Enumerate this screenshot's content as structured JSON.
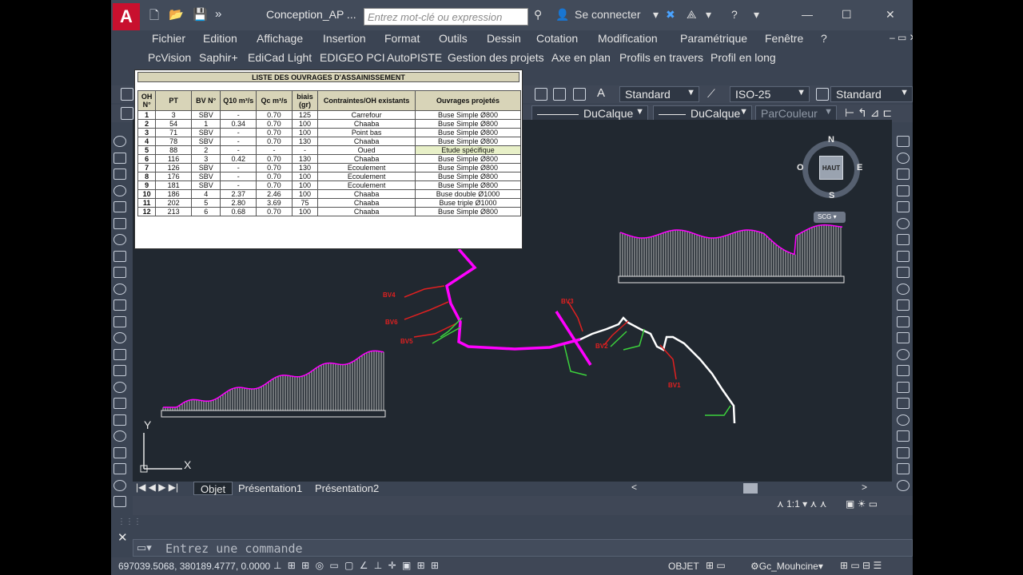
{
  "window": {
    "title": "Conception_AP ...",
    "search_placeholder": "Entrez mot-clé ou expression",
    "signin": "Se connecter",
    "help": "?",
    "min": "—",
    "max": "☐",
    "close": "✕"
  },
  "menu": [
    "Fichier",
    "Edition",
    "Affichage",
    "Insertion",
    "Format",
    "Outils",
    "Dessin",
    "Cotation",
    "Modification",
    "Paramétrique",
    "Fenêtre",
    "?"
  ],
  "menu2": [
    "PcVision",
    "Saphir+",
    "EdiCad Light",
    "EDIGEO PCI",
    "AutoPISTE",
    "Gestion des projets",
    "Axe en plan",
    "Profils en travers",
    "Profil en long"
  ],
  "toolbar": {
    "text_style": "Standard",
    "dim_style": "ISO-25",
    "table_style": "Standard",
    "linetype": "DuCalque",
    "lineweight": "DuCalque",
    "plotstyle": "ParCouleur"
  },
  "table": {
    "title": "LISTE DES OUVRAGES D'ASSAINISSEMENT",
    "headers": [
      "OH N°",
      "PT",
      "BV N°",
      "Q10 m³/s",
      "Qc m³/s",
      "biais (gr)",
      "Contraintes/OH existants",
      "Ouvrages projetés"
    ],
    "rows": [
      [
        "1",
        "3",
        "SBV",
        "-",
        "0.70",
        "125",
        "Carrefour",
        "Buse Simple Ø800"
      ],
      [
        "2",
        "54",
        "1",
        "0.34",
        "0.70",
        "100",
        "Chaaba",
        "Buse Simple Ø800"
      ],
      [
        "3",
        "71",
        "SBV",
        "-",
        "0.70",
        "100",
        "Point bas",
        "Buse Simple Ø800"
      ],
      [
        "4",
        "78",
        "SBV",
        "-",
        "0.70",
        "130",
        "Chaaba",
        "Buse Simple Ø800"
      ],
      [
        "5",
        "88",
        "2",
        "-",
        "-",
        "-",
        "Oued",
        "Etude spécifique"
      ],
      [
        "6",
        "116",
        "3",
        "0.42",
        "0.70",
        "130",
        "Chaaba",
        "Buse Simple Ø800"
      ],
      [
        "7",
        "126",
        "SBV",
        "-",
        "0.70",
        "130",
        "Ecoulement",
        "Buse Simple Ø800"
      ],
      [
        "8",
        "176",
        "SBV",
        "-",
        "0.70",
        "100",
        "Ecoulement",
        "Buse Simple Ø800"
      ],
      [
        "9",
        "181",
        "SBV",
        "-",
        "0.70",
        "100",
        "Ecoulement",
        "Buse Simple Ø800"
      ],
      [
        "10",
        "186",
        "4",
        "2.37",
        "2.46",
        "100",
        "Chaaba",
        "Buse double Ø1000"
      ],
      [
        "11",
        "202",
        "5",
        "2.80",
        "3.69",
        "75",
        "Chaaba",
        "Buse triple Ø1000"
      ],
      [
        "12",
        "213",
        "6",
        "0.68",
        "0.70",
        "100",
        "Chaaba",
        "Buse Simple Ø800"
      ]
    ],
    "header_bg": "#d8d4b8",
    "highlight_bg": "#e8f0c8"
  },
  "viewcube": {
    "n": "N",
    "s": "S",
    "e": "E",
    "w": "O",
    "face": "HAUT",
    "ucs": "SCG"
  },
  "bv_labels": [
    "BV4",
    "BV6",
    "BV5",
    "BV3",
    "BV2",
    "BV1"
  ],
  "ucs": {
    "y": "Y",
    "x": "X"
  },
  "layout_tabs": [
    "Objet",
    "Présentation1",
    "Présentation2"
  ],
  "command_placeholder": "Entrez une commande",
  "status": {
    "coords": "697039.5068, 380189.4777, 0.0000",
    "model": "OBJET",
    "workspace": "Gc_Mouhcine",
    "scale": "1:1"
  },
  "colors": {
    "magenta": "#ff00ff",
    "green": "#3cd23c",
    "red": "#e02020",
    "white": "#ffffff",
    "blue": "#3030ff"
  }
}
